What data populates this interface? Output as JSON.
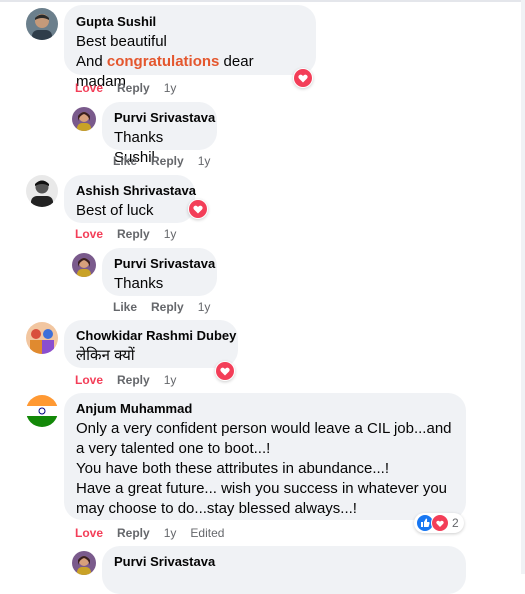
{
  "comments": [
    {
      "author": "Gupta Sushil",
      "line1": "Best beautiful",
      "line2_pre": "And ",
      "line2_highlight": "congratulations",
      "line2_post": " dear madam",
      "love": "Love",
      "reply": "Reply",
      "time": "1y"
    },
    {
      "author": "Purvi Srivastava",
      "text": "Thanks Sushil",
      "like": "Like",
      "reply": "Reply",
      "time": "1y"
    },
    {
      "author": "Ashish Shrivastava",
      "text": "Best of luck",
      "love": "Love",
      "reply": "Reply",
      "time": "1y"
    },
    {
      "author": "Purvi Srivastava",
      "text": "Thanks",
      "like": "Like",
      "reply": "Reply",
      "time": "1y"
    },
    {
      "author": "Chowkidar Rashmi Dubey",
      "text": "लेकिन क्यों",
      "love": "Love",
      "reply": "Reply",
      "time": "1y"
    },
    {
      "author": "Anjum Muhammad",
      "lines": [
        "Only a very confident person would leave a CIL job...and",
        "a very talented one to boot...!",
        "You have both these attributes in abundance...!",
        "Have a great future... wish you success in whatever you",
        "may choose to do...stay blessed always...!"
      ],
      "love": "Love",
      "reply": "Reply",
      "time": "1y",
      "edited": "Edited",
      "reaction_count": "2"
    },
    {
      "author": "Purvi Srivastava"
    }
  ],
  "colors": {
    "love": "#f33e58",
    "bubble": "#f0f2f5",
    "meta": "#65676b",
    "like_blue": "#1877f2"
  },
  "icons": {
    "love_reaction": "heart-icon",
    "like_reaction": "thumbs-up-icon"
  }
}
